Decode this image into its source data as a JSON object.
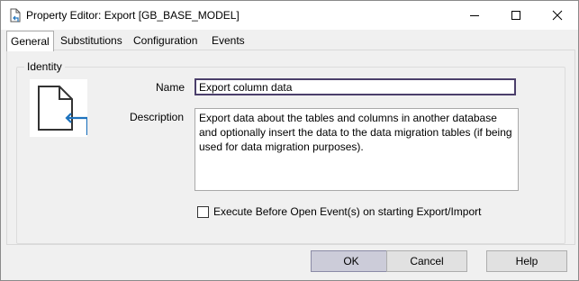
{
  "window": {
    "title": "Property Editor: Export [GB_BASE_MODEL]",
    "icon": "document-link-icon"
  },
  "tabs": [
    {
      "label": "General",
      "active": true
    },
    {
      "label": "Substitutions",
      "active": false
    },
    {
      "label": "Configuration",
      "active": false
    },
    {
      "label": "Events",
      "active": false
    }
  ],
  "identity": {
    "legend": "Identity",
    "name_label": "Name",
    "name_value": "Export column data",
    "description_label": "Description",
    "description_value": "Export data about the tables and columns in another database and optionally insert the data to the data migration tables (if being used for data migration purposes).",
    "checkbox_label": "Execute Before Open Event(s) on starting Export/Import",
    "checkbox_checked": false
  },
  "buttons": {
    "ok": "OK",
    "cancel": "Cancel",
    "help": "Help"
  },
  "colors": {
    "focus_border": "#4b3f6b",
    "accent_arrow": "#1e73be"
  }
}
